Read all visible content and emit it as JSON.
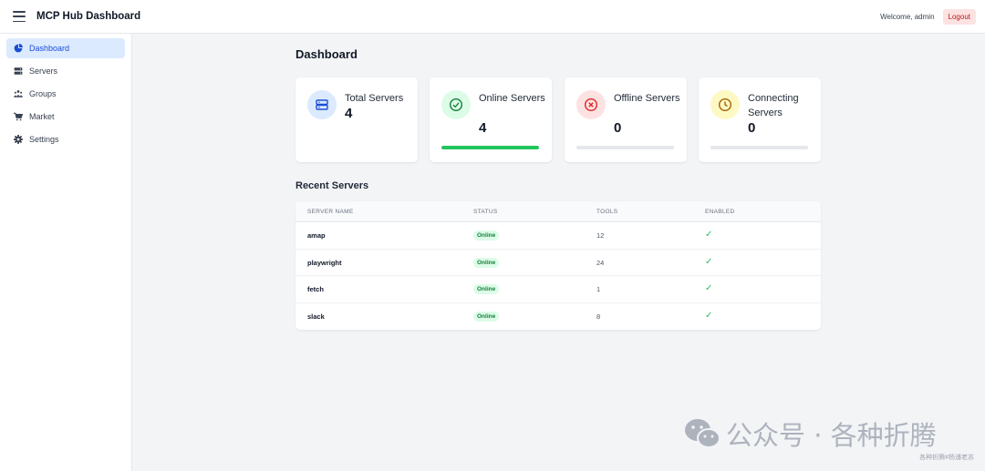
{
  "header": {
    "app_title": "MCP Hub Dashboard",
    "welcome": "Welcome, admin",
    "logout_label": "Logout"
  },
  "sidebar": {
    "items": [
      {
        "label": "Dashboard",
        "icon": "pie-chart-icon",
        "active": true
      },
      {
        "label": "Servers",
        "icon": "server-icon",
        "active": false
      },
      {
        "label": "Groups",
        "icon": "users-icon",
        "active": false
      },
      {
        "label": "Market",
        "icon": "cart-icon",
        "active": false
      },
      {
        "label": "Settings",
        "icon": "gear-icon",
        "active": false
      }
    ]
  },
  "main": {
    "title": "Dashboard",
    "cards": [
      {
        "label": "Total Servers",
        "value": "4",
        "icon": "server-icon",
        "color": "#3b82f6"
      },
      {
        "label": "Online Servers",
        "value": "4",
        "icon": "check-circle-icon",
        "color": "#22c55e",
        "progress": 1.0
      },
      {
        "label": "Offline Servers",
        "value": "0",
        "icon": "x-circle-icon",
        "color": "#ef4444",
        "progress": 0.0
      },
      {
        "label": "Connecting Servers",
        "value": "0",
        "icon": "clock-icon",
        "color": "#eab308",
        "progress": 0.0
      }
    ],
    "recent_title": "Recent Servers",
    "table": {
      "columns": [
        "SERVER NAME",
        "STATUS",
        "TOOLS",
        "ENABLED"
      ],
      "rows": [
        {
          "name": "amap",
          "status": "Online",
          "tools": "12",
          "enabled": "✓"
        },
        {
          "name": "playwright",
          "status": "Online",
          "tools": "24",
          "enabled": "✓"
        },
        {
          "name": "fetch",
          "status": "Online",
          "tools": "1",
          "enabled": "✓"
        },
        {
          "name": "slack",
          "status": "Online",
          "tools": "8",
          "enabled": "✓"
        }
      ]
    }
  },
  "watermark": {
    "text": "公众号 · 各种折腾",
    "small": "各种折腾#杨浦老苏"
  },
  "colors": {
    "accent": "#1d4ed8",
    "online": "#22c55e",
    "logout_bg": "#fde2e2"
  }
}
